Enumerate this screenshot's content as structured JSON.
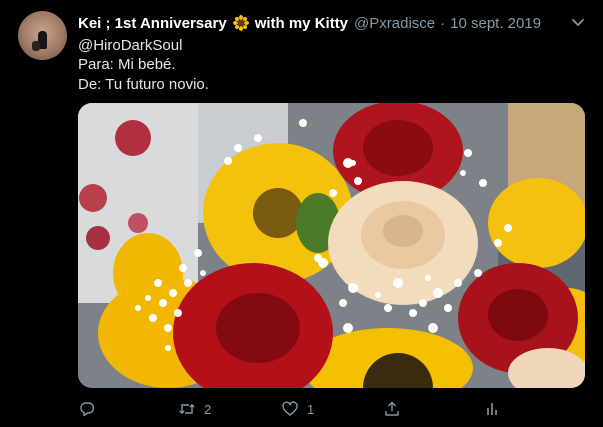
{
  "tweet": {
    "author_name": "Kei ; 1st Anniversary",
    "author_emoji": "sunflower",
    "author_name_suffix": "with my Kitty",
    "handle": "@Pxradisce",
    "separator": "·",
    "date": "10 sept. 2019",
    "lines": [
      "@HiroDarkSoul",
      "Para: Mi bebé.",
      "De: Tu futuro novio."
    ],
    "image_alt": "bouquet of red roses, cream rose, sunflowers and baby's breath"
  },
  "actions": {
    "reply_count": "",
    "retweet_count": "2",
    "like_count": "1"
  },
  "icons": [
    "reply-icon",
    "retweet-icon",
    "like-icon",
    "share-icon",
    "analytics-icon",
    "chevron-down-icon",
    "sunflower-emoji-icon"
  ],
  "colors": {
    "background": "#000000",
    "text": "#d9d9d9",
    "muted": "#8899a6",
    "name": "#ffffff"
  }
}
